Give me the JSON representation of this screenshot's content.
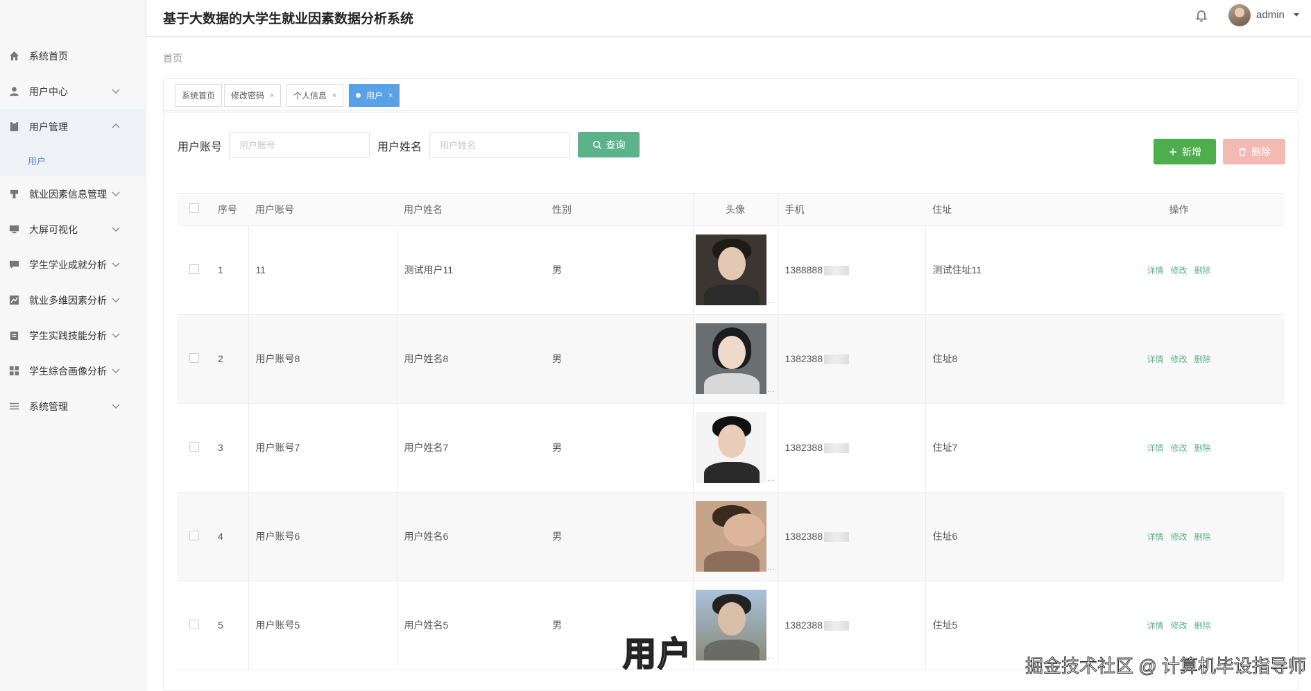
{
  "header": {
    "title": "基于大数据的大学生就业因素数据分析系统",
    "user": "admin"
  },
  "sidebar": {
    "items": [
      {
        "label": "系统首页",
        "icon": "home-icon"
      },
      {
        "label": "用户中心",
        "icon": "user-icon"
      },
      {
        "label": "用户管理",
        "icon": "id-card-icon",
        "expanded": true,
        "sub": [
          "用户"
        ]
      },
      {
        "label": "就业因素信息管理",
        "icon": "bookmark-icon"
      },
      {
        "label": "大屏可视化",
        "icon": "monitor-icon"
      },
      {
        "label": "学生学业成就分析",
        "icon": "chat-icon"
      },
      {
        "label": "就业多维因素分析",
        "icon": "chart-icon"
      },
      {
        "label": "学生实践技能分析",
        "icon": "clipboard-icon"
      },
      {
        "label": "学生综合画像分析",
        "icon": "grid-icon"
      },
      {
        "label": "系统管理",
        "icon": "list-icon"
      }
    ]
  },
  "breadcrumb": "首页",
  "tabs": [
    {
      "label": "系统首页"
    },
    {
      "label": "修改密码",
      "close": "×"
    },
    {
      "label": "个人信息",
      "close": "×"
    },
    {
      "label": "用户",
      "close": "×",
      "active": true
    }
  ],
  "search": {
    "account_label": "用户账号",
    "account_placeholder": "用户账号",
    "name_label": "用户姓名",
    "name_placeholder": "用户姓名",
    "query_label": "查询"
  },
  "actions": {
    "add_label": "新增",
    "delete_label": "删除"
  },
  "table": {
    "headers": [
      "序号",
      "用户账号",
      "用户姓名",
      "性别",
      "头像",
      "手机",
      "住址",
      "操作"
    ],
    "ops": [
      "详情",
      "修改",
      "删除"
    ],
    "rows": [
      {
        "no": "1",
        "account": "11",
        "name": "测试用户11",
        "gender": "男",
        "phone": "1388888",
        "address": "测试住址11"
      },
      {
        "no": "2",
        "account": "用户账号8",
        "name": "用户姓名8",
        "gender": "男",
        "phone": "1382388",
        "address": "住址8"
      },
      {
        "no": "3",
        "account": "用户账号7",
        "name": "用户姓名7",
        "gender": "男",
        "phone": "1382388",
        "address": "住址7"
      },
      {
        "no": "4",
        "account": "用户账号6",
        "name": "用户姓名6",
        "gender": "男",
        "phone": "1382388",
        "address": "住址6"
      },
      {
        "no": "5",
        "account": "用户账号5",
        "name": "用户姓名5",
        "gender": "男",
        "phone": "1382388",
        "address": "住址5"
      }
    ]
  },
  "watermark": {
    "caption": "用户",
    "credit": "掘金技术社区 @ 计算机毕设指导师"
  },
  "colors": {
    "primary": "#5cb28a",
    "add": "#4cae4c",
    "delete": "#f3b9b3",
    "tab_active": "#5aa2e8",
    "submenu_active": "#4d90d6"
  }
}
